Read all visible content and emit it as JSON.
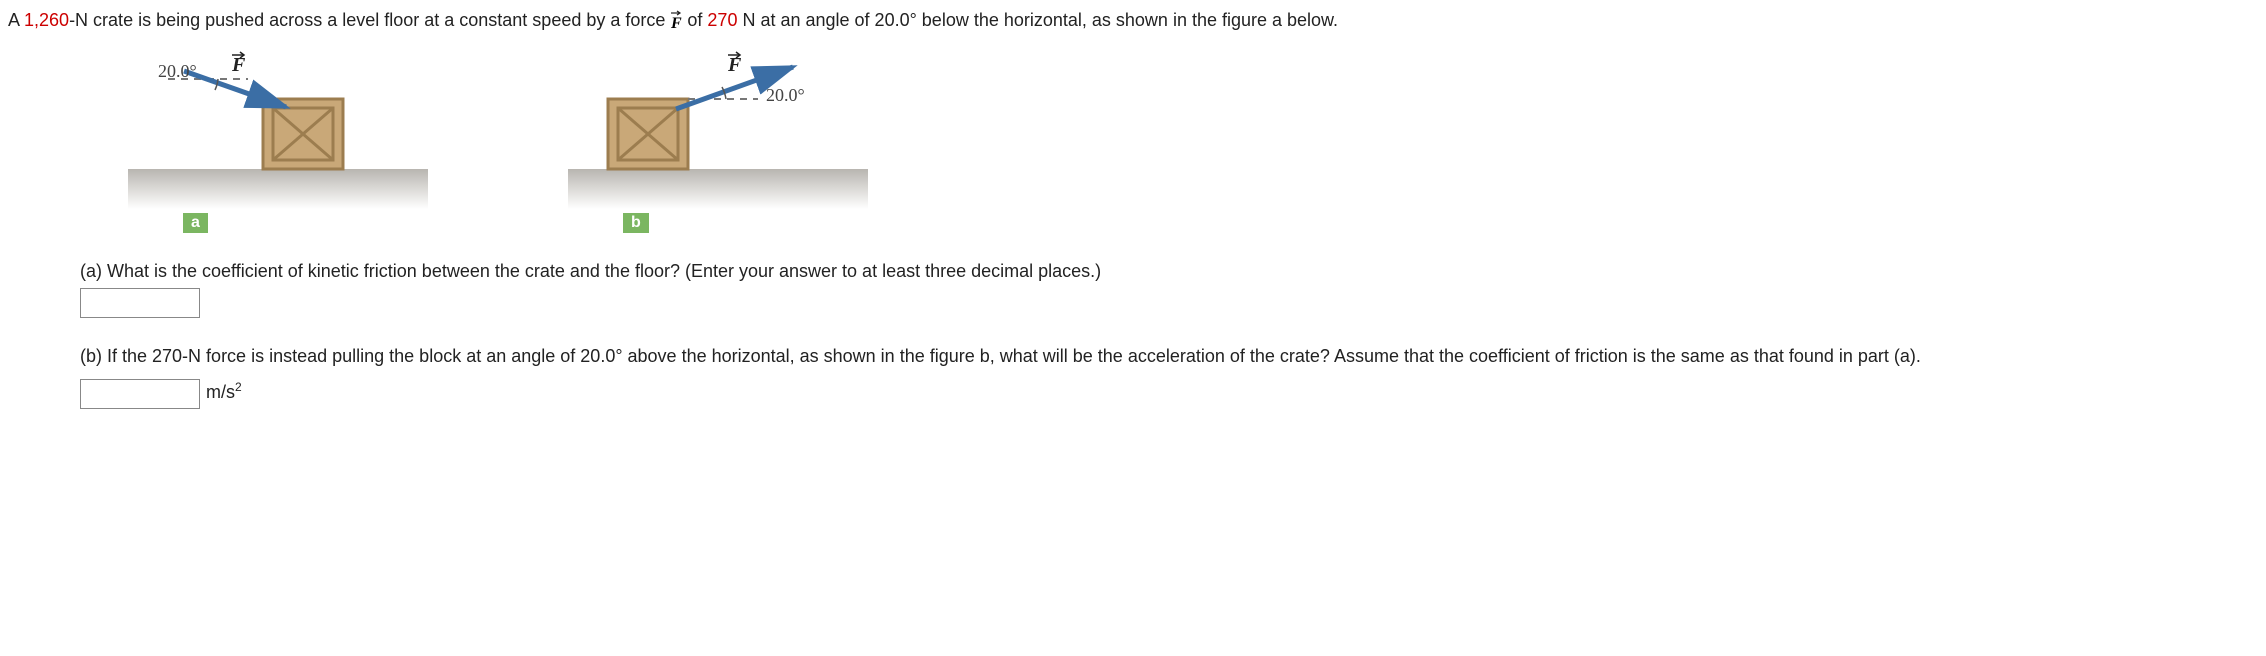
{
  "statement": {
    "pre": "A ",
    "weight": "1,260",
    "mid1": "-N crate is being pushed across a level floor at a constant speed by a force ",
    "force_symbol": "F",
    "mid2": " of ",
    "force_value": "270",
    "mid3": " N at an angle of 20.0° below the horizontal, as shown in the figure a below."
  },
  "figures": {
    "a": {
      "angle": "20.0°",
      "force": "F",
      "label": "a"
    },
    "b": {
      "angle": "20.0°",
      "force": "F",
      "label": "b"
    }
  },
  "part_a": {
    "text": "(a) What is the coefficient of kinetic friction between the crate and the floor? (Enter your answer to at least three decimal places.)"
  },
  "part_b": {
    "text": "(b) If the 270-N force is instead pulling the block at an angle of 20.0° above the horizontal, as shown in the figure b, what will be the acceleration of the crate? Assume that the coefficient of friction is the same as that found in part (a).",
    "unit": "m/s"
  }
}
